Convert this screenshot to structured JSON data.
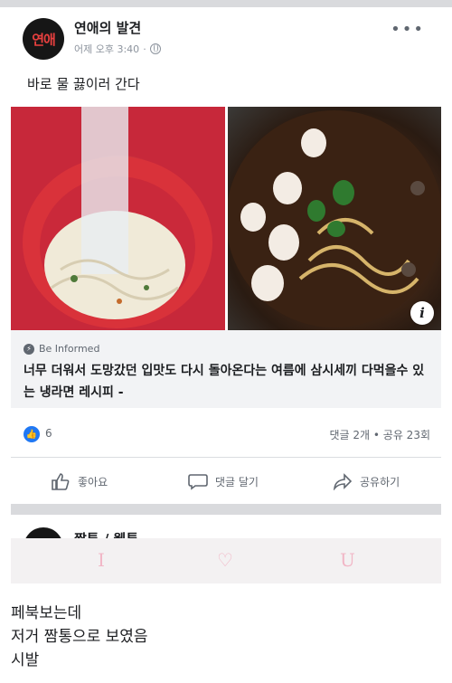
{
  "post": {
    "page_name": "연애의 발견",
    "avatar_text": "연애",
    "timestamp": "어제 오후 3:40",
    "text": "바로 물 끓이러 간다"
  },
  "link": {
    "source": "Be Informed",
    "title": "너무 더워서 도망갔던 입맛도 다시 돌아온다는 여름에 삼시세끼 다먹을수 있는 냉라면 레시피 -"
  },
  "stats": {
    "likes": "6",
    "comments_shares": "댓글 2개 • 공유 23회"
  },
  "actions": {
    "like": "좋아요",
    "comment": "댓글 달기",
    "share": "공유하기"
  },
  "next_post": {
    "page_name": "짤툰 / 웹툰"
  },
  "watermark": {
    "left": "I",
    "middle": "♡",
    "right": "U"
  },
  "caption": {
    "line1": "페북보는데",
    "line2": "저거 짬통으로 보였음",
    "line3": "시발"
  },
  "colors": {
    "like_blue": "#2078f4",
    "text": "#1c1e21",
    "muted": "#606770"
  }
}
